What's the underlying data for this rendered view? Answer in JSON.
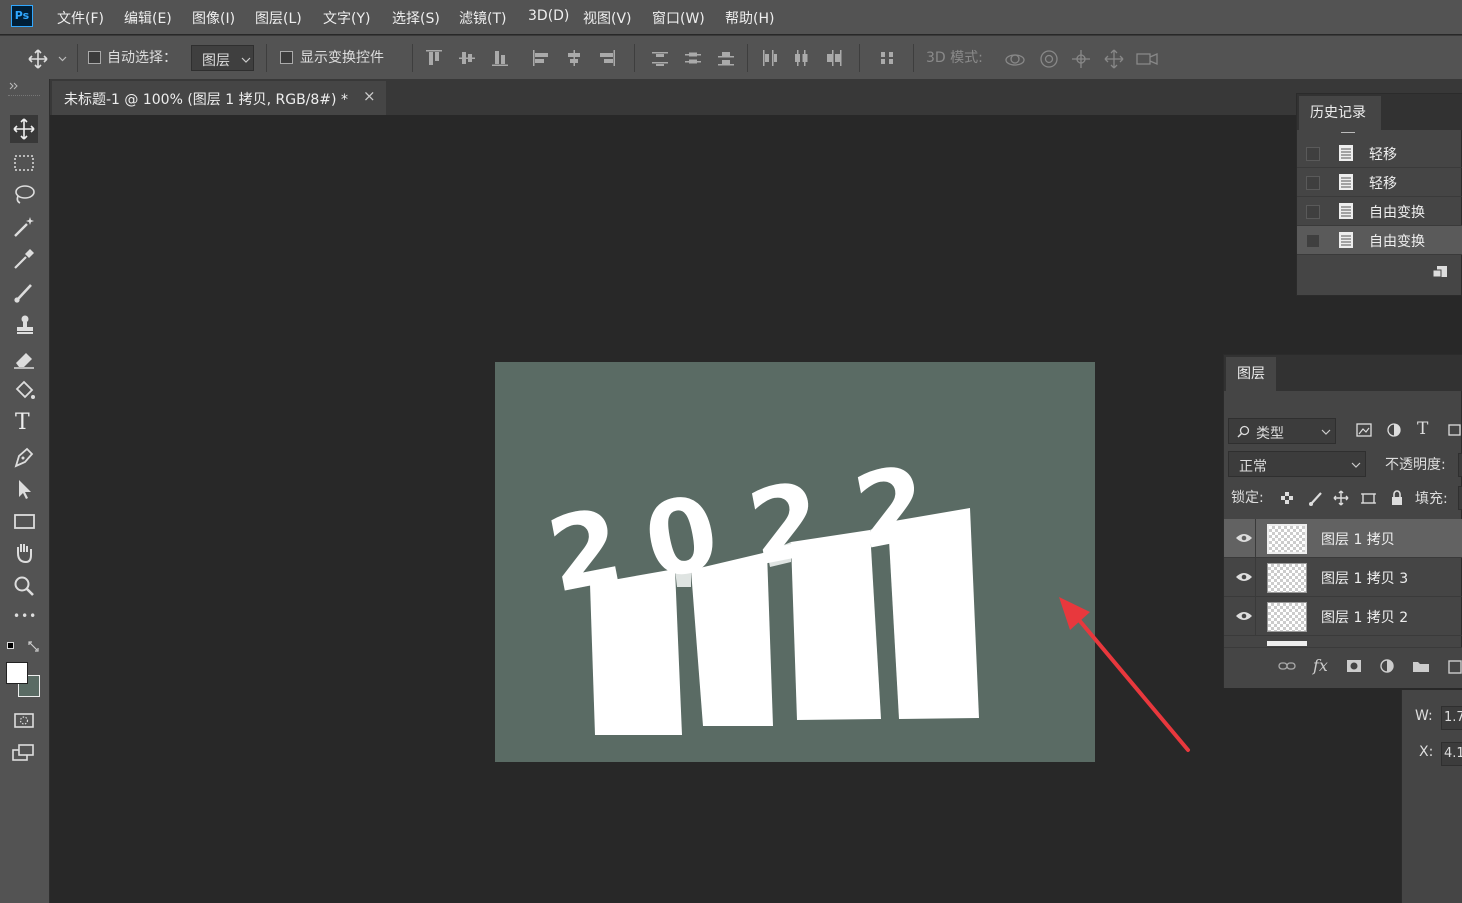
{
  "app": {
    "logo": "Ps"
  },
  "menu": [
    "文件(F)",
    "编辑(E)",
    "图像(I)",
    "图层(L)",
    "文字(Y)",
    "选择(S)",
    "滤镜(T)",
    "3D(D)",
    "视图(V)",
    "窗口(W)",
    "帮助(H)"
  ],
  "options": {
    "auto_select_label": "自动选择：",
    "auto_select_value": "图层",
    "show_transform_label": "显示变换控件",
    "mode_3d_label": "3D 模式:"
  },
  "document": {
    "tab_title": "未标题-1 @ 100% (图层 1 拷贝, RGB/8#) *",
    "close": "×"
  },
  "canvas": {
    "background_color": "#5a6b64",
    "artwork_text": "2022",
    "arrow_color": "#e8383d"
  },
  "history": {
    "title": "历史记录",
    "items": [
      {
        "label": "轻移",
        "selected": false
      },
      {
        "label": "轻移",
        "selected": false
      },
      {
        "label": "自由变换",
        "selected": false
      },
      {
        "label": "自由变换",
        "selected": true
      }
    ]
  },
  "layers": {
    "title": "图层",
    "filter_label": "类型",
    "blend_mode": "正常",
    "opacity_label": "不透明度:",
    "lock_label": "锁定:",
    "fill_label": "填充:",
    "items": [
      {
        "name": "图层 1 拷贝",
        "selected": true
      },
      {
        "name": "图层 1 拷贝 3",
        "selected": false
      },
      {
        "name": "图层 1 拷贝 2",
        "selected": false
      }
    ],
    "footer_fx": "fx"
  },
  "properties": {
    "w_label": "W:",
    "w_value": "1.7",
    "x_label": "X:",
    "x_value": "4.1"
  },
  "toolbar": {
    "tools": [
      "move",
      "rect-marquee",
      "lasso",
      "magic-wand",
      "eyedropper",
      "brush",
      "clone-stamp",
      "eraser",
      "paint-bucket",
      "type",
      "pen",
      "path-select",
      "rectangle",
      "hand",
      "zoom",
      "more"
    ],
    "type_tool_glyph": "T",
    "more_glyph": "•••"
  }
}
